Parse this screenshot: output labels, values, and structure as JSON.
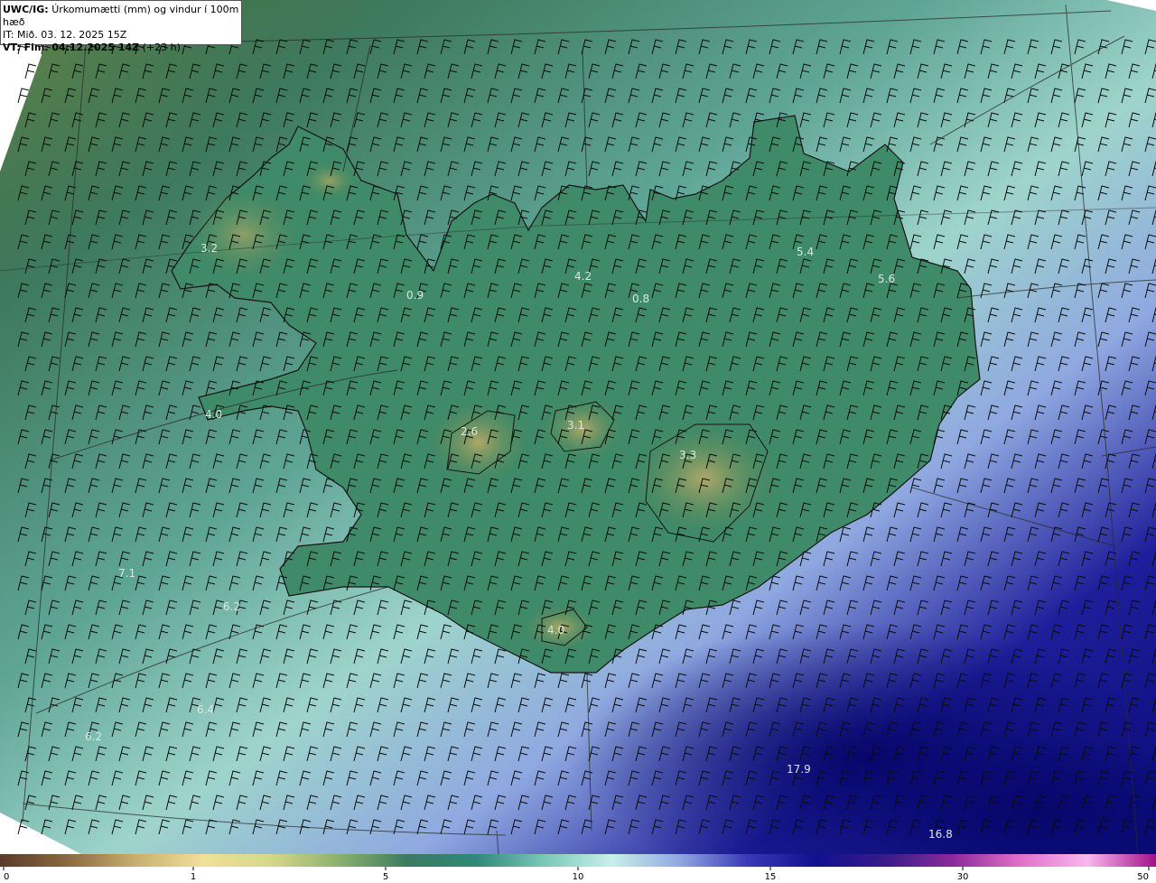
{
  "info": {
    "product_label": "UWC/IG:",
    "product_desc": "Úrkomumætti (mm) og vindur í 100m hæð",
    "it_line": "IT: Mið. 03. 12. 2025 15Z",
    "vt_label": "VT: Fim. 04.12.2025 14Z",
    "vt_lead": "(+23 h)"
  },
  "map_labels": [
    "3.2",
    "0.9",
    "4.2",
    "0.8",
    "5.4",
    "5.6",
    "4.0",
    "2.6",
    "3.1",
    "3.3",
    "7.1",
    "6.2",
    "4.0",
    "6.4",
    "6.2",
    "17.9",
    "16.8"
  ],
  "colorbar": {
    "ticks": [
      "0",
      "1",
      "5",
      "10",
      "15",
      "30",
      "50"
    ],
    "stops": [
      "#5a3a28",
      "#8a6a40",
      "#c8b070",
      "#f0e09a",
      "#d6d68a",
      "#8ab070",
      "#3a7a60",
      "#2e8a78",
      "#7ac8b8",
      "#c8f0ec",
      "#90a8e0",
      "#3838b8",
      "#101090",
      "#3a1a8a",
      "#8a2a9a",
      "#e070c8",
      "#f8b8ec",
      "#a0108a"
    ]
  },
  "colors": {
    "ocean_nw": "#3a7a68",
    "ocean_se": "#0a0a88",
    "land": "#3e8a68",
    "coast": "#141414",
    "barb": "#0c0c0c"
  }
}
